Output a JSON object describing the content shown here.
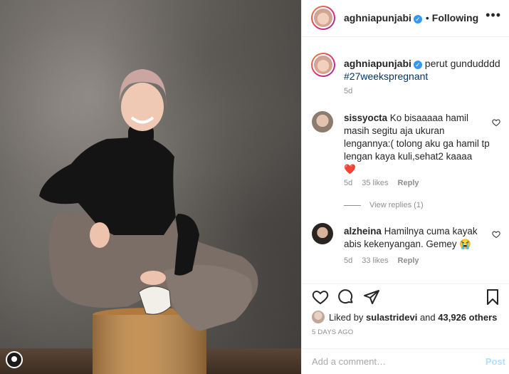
{
  "post": {
    "username": "aghniapunjabi",
    "separator": "•",
    "follow_status": "Following",
    "more_icon": "more-horizontal-icon"
  },
  "caption": {
    "username": "aghniapunjabi",
    "text": "perut gundudddd",
    "hashtag": "#27weekspregnant",
    "time": "5d"
  },
  "comments": [
    {
      "username": "sissyocta",
      "text": "Ko bisaaaaa hamil masih segitu aja ukuran lengannya:( tolong aku ga hamil tp lengan kaya kuli,sehat2 kaaaa",
      "emoji": "❤️",
      "time": "5d",
      "likes": "35 likes",
      "reply": "Reply",
      "view_replies": "View replies (1)"
    },
    {
      "username": "alzheina",
      "text": "Hamilnya cuma kayak abis kekenyangan. Gemey",
      "emoji": "😭",
      "time": "5d",
      "likes": "33 likes",
      "reply": "Reply"
    }
  ],
  "likes": {
    "prefix": "Liked by",
    "user": "sulastridevi",
    "connector": "and",
    "count": "43,926 others"
  },
  "date": "5 DAYS AGO",
  "add_comment": {
    "placeholder": "Add a comment…",
    "post_label": "Post"
  },
  "colors": {
    "accent": "#3897f0",
    "hashtag": "#003569",
    "muted": "#8e8e8e",
    "heart": "#ed4956"
  }
}
